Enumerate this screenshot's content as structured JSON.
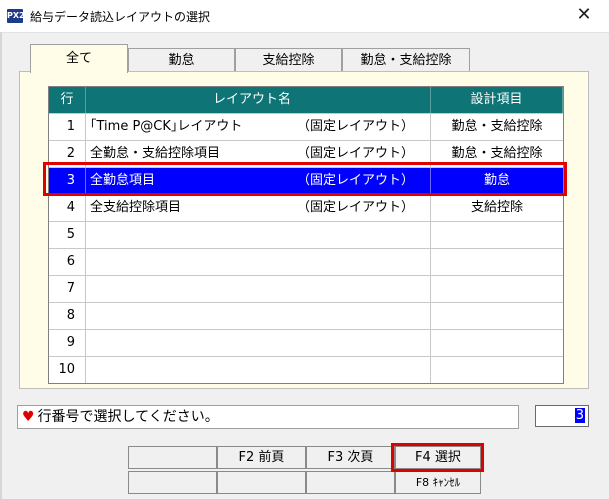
{
  "window": {
    "icon_text": "PX2",
    "title": "給与データ読込レイアウトの選択",
    "close_symbol": "✕"
  },
  "tabs": [
    {
      "label": "全て",
      "active": true
    },
    {
      "label": "勤怠",
      "active": false
    },
    {
      "label": "支給控除",
      "active": false
    },
    {
      "label": "勤怠・支給控除",
      "active": false
    }
  ],
  "table": {
    "headers": {
      "no": "行",
      "layout": "レイアウト名",
      "item": "設計項目"
    },
    "rows": [
      {
        "no": "1",
        "name": "｢Time P@CK｣レイアウト",
        "note": "（固定レイアウト）",
        "item": "勤怠・支給控除"
      },
      {
        "no": "2",
        "name": "全勤怠・支給控除項目",
        "note": "（固定レイアウト）",
        "item": "勤怠・支給控除"
      },
      {
        "no": "3",
        "name": "全勤怠項目",
        "note": "（固定レイアウト）",
        "item": "勤怠",
        "selected": true
      },
      {
        "no": "4",
        "name": "全支給控除項目",
        "note": "（固定レイアウト）",
        "item": "支給控除"
      },
      {
        "no": "5",
        "name": "",
        "note": "",
        "item": ""
      },
      {
        "no": "6",
        "name": "",
        "note": "",
        "item": ""
      },
      {
        "no": "7",
        "name": "",
        "note": "",
        "item": ""
      },
      {
        "no": "8",
        "name": "",
        "note": "",
        "item": ""
      },
      {
        "no": "9",
        "name": "",
        "note": "",
        "item": ""
      },
      {
        "no": "10",
        "name": "",
        "note": "",
        "item": ""
      }
    ]
  },
  "message": {
    "icon": "heart-icon",
    "text": "行番号で選択してください。"
  },
  "row_number_input": {
    "value": "3"
  },
  "function_keys": {
    "f2": "F2 前頁",
    "f3": "F3 次頁",
    "f4": "F4 選択",
    "f8": "F8 ｷｬﾝｾﾙ"
  },
  "colors": {
    "header": "#0e7476",
    "selected_row": "#0000ff",
    "highlight": "#e00000",
    "panel": "#fffde8"
  }
}
